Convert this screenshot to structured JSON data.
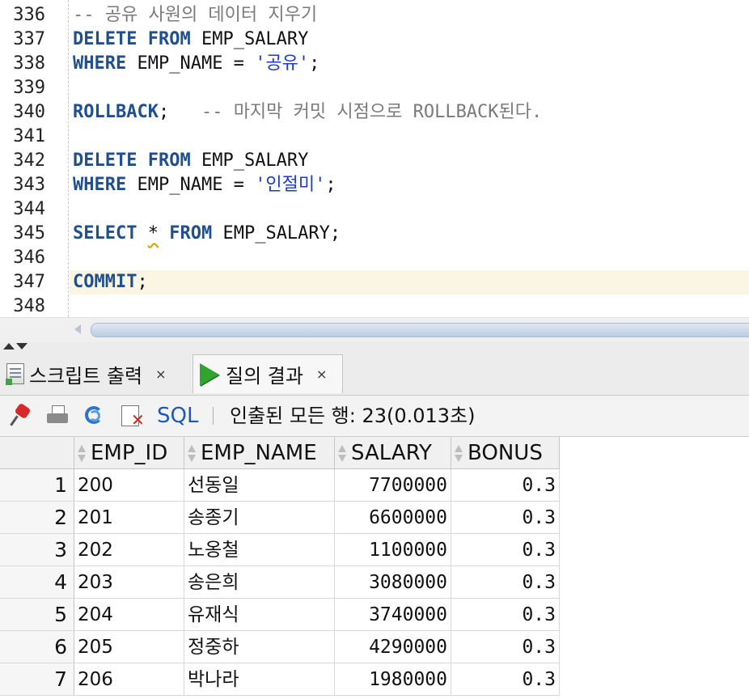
{
  "editor": {
    "lines": [
      {
        "num": "336",
        "segments": [
          {
            "t": "-- 공유 사원의 데이터 지우기",
            "c": "cm"
          }
        ]
      },
      {
        "num": "337",
        "segments": [
          {
            "t": "DELETE",
            "c": "kw"
          },
          {
            "t": " ",
            "c": ""
          },
          {
            "t": "FROM",
            "c": "kw"
          },
          {
            "t": " EMP_SALARY",
            "c": ""
          }
        ]
      },
      {
        "num": "338",
        "segments": [
          {
            "t": "WHERE",
            "c": "kw"
          },
          {
            "t": " EMP_NAME = ",
            "c": ""
          },
          {
            "t": "'공유'",
            "c": "st"
          },
          {
            "t": ";",
            "c": ""
          }
        ]
      },
      {
        "num": "339",
        "segments": []
      },
      {
        "num": "340",
        "segments": [
          {
            "t": "ROLLBACK",
            "c": "kw"
          },
          {
            "t": ";   ",
            "c": ""
          },
          {
            "t": "-- 마지막 커밋 시점으로 ROLLBACK된다.",
            "c": "cm"
          }
        ]
      },
      {
        "num": "341",
        "segments": []
      },
      {
        "num": "342",
        "segments": [
          {
            "t": "DELETE",
            "c": "kw"
          },
          {
            "t": " ",
            "c": ""
          },
          {
            "t": "FROM",
            "c": "kw"
          },
          {
            "t": " EMP_SALARY",
            "c": ""
          }
        ]
      },
      {
        "num": "343",
        "segments": [
          {
            "t": "WHERE",
            "c": "kw"
          },
          {
            "t": " EMP_NAME = ",
            "c": ""
          },
          {
            "t": "'인절미'",
            "c": "st"
          },
          {
            "t": ";",
            "c": ""
          }
        ]
      },
      {
        "num": "344",
        "segments": []
      },
      {
        "num": "345",
        "segments": [
          {
            "t": "SELECT",
            "c": "kw"
          },
          {
            "t": " ",
            "c": ""
          },
          {
            "t": "*",
            "c": "sq"
          },
          {
            "t": " ",
            "c": ""
          },
          {
            "t": "FROM",
            "c": "kw"
          },
          {
            "t": " EMP_SALARY;",
            "c": ""
          }
        ]
      },
      {
        "num": "346",
        "segments": []
      },
      {
        "num": "347",
        "segments": [
          {
            "t": "COMMIT",
            "c": "kw"
          },
          {
            "t": ";",
            "c": ""
          }
        ],
        "current": true
      },
      {
        "num": "348",
        "segments": []
      }
    ]
  },
  "tabs": [
    {
      "label": "스크립트 출력",
      "close": "×"
    },
    {
      "label": "질의 결과",
      "close": "×"
    }
  ],
  "toolbar": {
    "sql_label": "SQL",
    "separator": "|",
    "status": "인출된 모든 행: 23(0.013초)"
  },
  "grid": {
    "columns": [
      "EMP_ID",
      "EMP_NAME",
      "SALARY",
      "BONUS"
    ],
    "rows": [
      {
        "n": "1",
        "id": "200",
        "name": "선동일",
        "salary": "7700000",
        "bonus": "0.3"
      },
      {
        "n": "2",
        "id": "201",
        "name": "송종기",
        "salary": "6600000",
        "bonus": "0.3"
      },
      {
        "n": "3",
        "id": "202",
        "name": "노옹철",
        "salary": "1100000",
        "bonus": "0.3"
      },
      {
        "n": "4",
        "id": "203",
        "name": "송은희",
        "salary": "3080000",
        "bonus": "0.3"
      },
      {
        "n": "5",
        "id": "204",
        "name": "유재식",
        "salary": "3740000",
        "bonus": "0.3"
      },
      {
        "n": "6",
        "id": "205",
        "name": "정중하",
        "salary": "4290000",
        "bonus": "0.3"
      },
      {
        "n": "7",
        "id": "206",
        "name": "박나라",
        "salary": "1980000",
        "bonus": "0.3"
      }
    ]
  },
  "colors": {
    "keyword": "#1f4f8f",
    "comment": "#7a7a7a",
    "string": "#1a3cc8",
    "current_line": "#fbf6e4"
  }
}
